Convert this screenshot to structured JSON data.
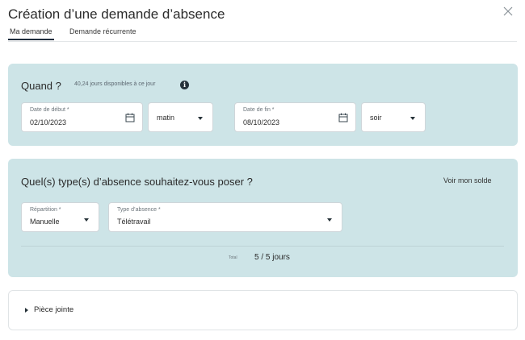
{
  "dialog": {
    "title": "Création d’une demande d’absence",
    "close_icon": "close-icon"
  },
  "tabs": [
    {
      "label": "Ma demande",
      "active": true
    },
    {
      "label": "Demande récurrente",
      "active": false
    }
  ],
  "when": {
    "title": "Quand ?",
    "days_available": "40,24 jours disponibles à ce jour",
    "info_icon": "info-icon",
    "start_date": {
      "label": "Date de début *",
      "value": "02/10/2023"
    },
    "start_period": {
      "value": "matin"
    },
    "end_date": {
      "label": "Date de fin *",
      "value": "08/10/2023"
    },
    "end_period": {
      "value": "soir"
    }
  },
  "type": {
    "title": "Quel(s) type(s) d’absence souhaitez-vous poser ?",
    "voir_solde": "Voir mon solde",
    "repartition": {
      "label": "Répartition *",
      "value": "Manuelle"
    },
    "absence_type": {
      "label": "Type d’absence *",
      "value": "Télétravail"
    },
    "total_label": "Total",
    "total_value": "5 / 5 jours"
  },
  "attachment": {
    "label": "Pièce jointe"
  },
  "colors": {
    "card_background": "#cde4e7",
    "text_primary": "#263238"
  }
}
